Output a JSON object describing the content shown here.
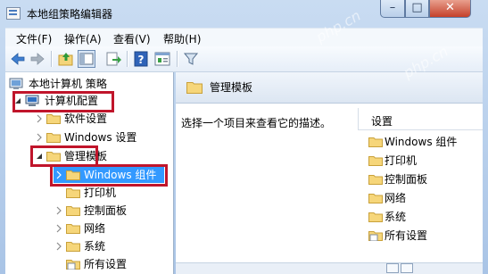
{
  "window": {
    "title": "本地组策略编辑器",
    "buttons": {
      "minimize": "–",
      "maximize": "□",
      "close": "✕"
    }
  },
  "menu": [
    "文件(F)",
    "操作(A)",
    "查看(V)",
    "帮助(H)"
  ],
  "toolbar": {
    "icons": [
      "back-arrow-icon",
      "forward-arrow-icon",
      "up-folder-icon",
      "show-hide-tree-icon",
      "export-list-icon",
      "help-icon",
      "properties-icon",
      "filter-icon"
    ]
  },
  "tree": {
    "root": "本地计算机 策略",
    "computer_config": "计算机配置",
    "software_settings": "软件设置",
    "windows_settings": "Windows 设置",
    "admin_templates": "管理模板",
    "windows_components": "Windows 组件",
    "printers": "打印机",
    "control_panel": "控制面板",
    "network": "网络",
    "system": "系统",
    "all_settings": "所有设置"
  },
  "right": {
    "title": "管理模板",
    "description": "选择一个项目来查看它的描述。",
    "column_header": "设置",
    "items": [
      "Windows 组件",
      "打印机",
      "控制面板",
      "网络",
      "系统",
      "所有设置"
    ]
  },
  "highlight_color": "#c0152b",
  "watermark": "php.cn"
}
